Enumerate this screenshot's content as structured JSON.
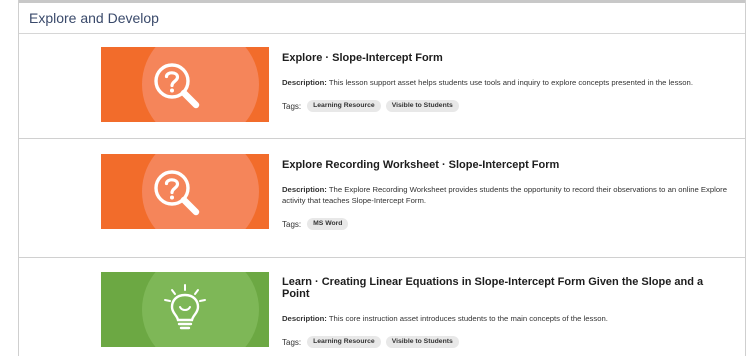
{
  "section": {
    "title": "Explore and Develop"
  },
  "labels": {
    "description": "Description:",
    "tags": "Tags:"
  },
  "colors": {
    "explore_orange": "#f26c2b",
    "explore_halo": "#f5855a",
    "learn_green": "#6ca843",
    "learn_halo": "#7eb757"
  },
  "items": [
    {
      "icon": "magnifier-question-icon",
      "title": "Explore · Slope-Intercept Form",
      "description": "This lesson support asset helps students use tools and inquiry to explore concepts presented in the lesson.",
      "tags": [
        "Learning Resource",
        "Visible to Students"
      ]
    },
    {
      "icon": "magnifier-question-icon",
      "title": "Explore Recording Worksheet · Slope-Intercept Form",
      "description": "The Explore Recording Worksheet provides students the opportunity to record their observations to an online Explore activity that teaches Slope-Intercept Form.",
      "tags": [
        "MS Word"
      ]
    },
    {
      "icon": "lightbulb-icon",
      "title": "Learn · Creating Linear Equations in Slope-Intercept Form Given the Slope and a Point",
      "description": "This core instruction asset introduces students to the main concepts of the lesson.",
      "tags": [
        "Learning Resource",
        "Visible to Students"
      ]
    }
  ]
}
